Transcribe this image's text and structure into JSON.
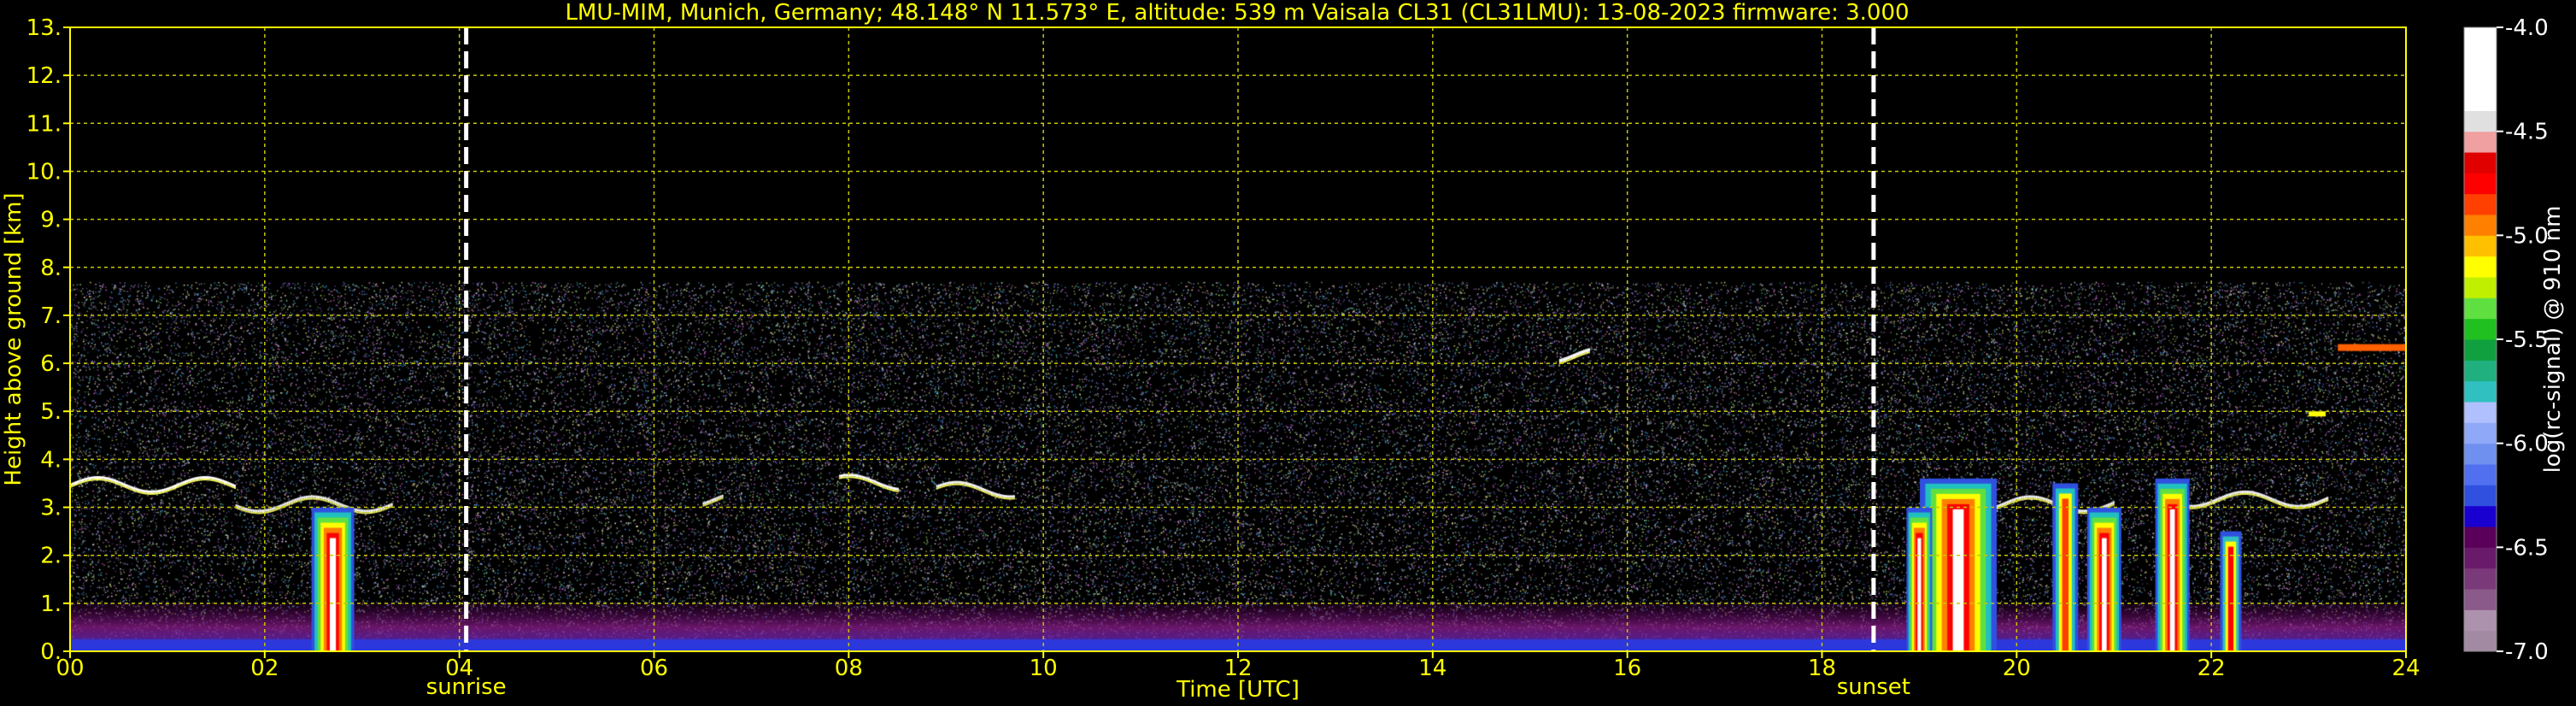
{
  "chart_data": {
    "type": "heatmap",
    "title": "LMU-MIM, Munich, Germany; 48.148° N 11.573° E, altitude: 539 m    Vaisala CL31 (CL31LMU): 13-08-2023    firmware: 3.000",
    "xlabel": "Time [UTC]",
    "ylabel": "Height above ground [km]",
    "xlim": [
      0,
      24
    ],
    "ylim": [
      0,
      13
    ],
    "x_ticks": [
      "00",
      "02",
      "04",
      "06",
      "08",
      "10",
      "12",
      "14",
      "16",
      "18",
      "20",
      "22",
      "24"
    ],
    "y_ticks": [
      "0.",
      "1.",
      "2.",
      "3.",
      "4.",
      "5.",
      "6.",
      "7.",
      "8.",
      "9.",
      "10.",
      "11.",
      "12.",
      "13."
    ],
    "grid": true,
    "colorbar": {
      "label": "log(rc-signal) @ 910 nm",
      "range": [
        -7.0,
        -4.0
      ],
      "ticks": [
        "-4.0",
        "-4.5",
        "-5.0",
        "-5.5",
        "-6.0",
        "-6.5",
        "-7.0"
      ],
      "colors": [
        "#a38aa3",
        "#ad92ad",
        "#8a5a8a",
        "#7a3a7a",
        "#6a1a6a",
        "#5a005a",
        "#1a00d0",
        "#3050e0",
        "#5070f0",
        "#7090f0",
        "#90a8f8",
        "#b0c0ff",
        "#30c0c0",
        "#20b080",
        "#10a040",
        "#20c020",
        "#60e040",
        "#c0f000",
        "#ffff00",
        "#ffc000",
        "#ff8000",
        "#ff4000",
        "#ff0000",
        "#e00000",
        "#f0a0a0",
        "#e0e0e0",
        "#ffffff",
        "#ffffff",
        "#ffffff",
        "#ffffff"
      ]
    },
    "markers": [
      {
        "label": "sunrise",
        "x": 4.07
      },
      {
        "label": "sunset",
        "x": 18.53
      }
    ],
    "data_limit_km": 7.7
  }
}
